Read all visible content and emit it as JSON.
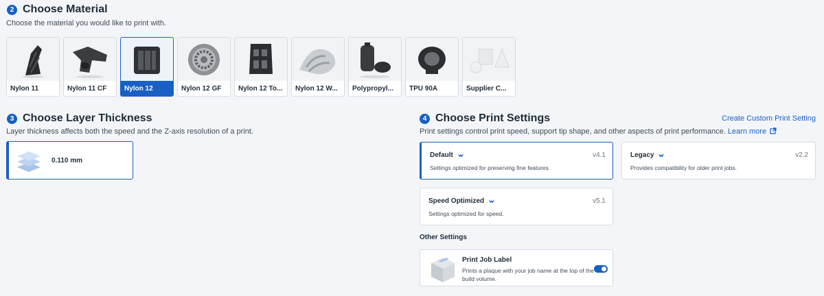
{
  "material": {
    "step": "2",
    "title": "Choose Material",
    "subtitle": "Choose the material you would like to print with.",
    "items": [
      {
        "label": "Nylon 11",
        "selected": false
      },
      {
        "label": "Nylon 11 CF",
        "selected": false
      },
      {
        "label": "Nylon 12",
        "selected": true
      },
      {
        "label": "Nylon 12 GF",
        "selected": false
      },
      {
        "label": "Nylon 12 To...",
        "selected": false
      },
      {
        "label": "Nylon 12 W...",
        "selected": false
      },
      {
        "label": "Polypropyl...",
        "selected": false
      },
      {
        "label": "TPU 90A",
        "selected": false
      },
      {
        "label": "Supplier C...",
        "selected": false
      }
    ]
  },
  "layer": {
    "step": "3",
    "title": "Choose Layer Thickness",
    "subtitle": "Layer thickness affects both the speed and the Z-axis resolution of a print.",
    "value": "0.110 mm"
  },
  "print_settings": {
    "step": "4",
    "title": "Choose Print Settings",
    "create_link": "Create Custom Print Setting",
    "subtitle": "Print settings control print speed, support tip shape, and other aspects of print performance.",
    "learn_more": "Learn more",
    "options": [
      {
        "name": "Default",
        "version": "v4.1",
        "desc": "Settings optimized for preserving fine features.",
        "selected": true
      },
      {
        "name": "Legacy",
        "version": "v2.2",
        "desc": "Provides compatibility for older print jobs.",
        "selected": false
      },
      {
        "name": "Speed Optimized",
        "version": "v5.1",
        "desc": "Settings optimized for speed.",
        "selected": false
      }
    ],
    "other_title": "Other Settings",
    "job_label": {
      "title": "Print Job Label",
      "desc": "Prints a plaque with your job name at the top of the build volume.",
      "enabled": true
    }
  },
  "colors": {
    "accent": "#1860c4",
    "background": "#f3f5f8"
  }
}
